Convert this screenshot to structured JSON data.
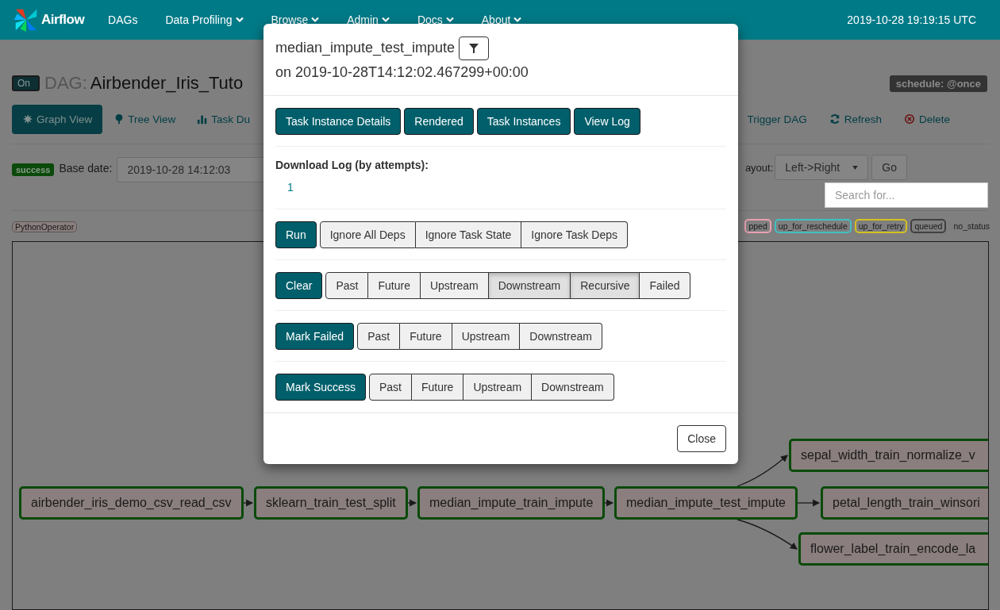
{
  "navbar": {
    "brand": "Airflow",
    "items": [
      {
        "label": "DAGs",
        "dropdown": false
      },
      {
        "label": "Data Profiling",
        "dropdown": true
      },
      {
        "label": "Browse",
        "dropdown": true
      },
      {
        "label": "Admin",
        "dropdown": true
      },
      {
        "label": "Docs",
        "dropdown": true
      },
      {
        "label": "About",
        "dropdown": true
      }
    ],
    "clock": "2019-10-28 19:19:15 UTC"
  },
  "dag_header": {
    "toggle": "On",
    "prefix": "DAG:",
    "name": "Airbender_Iris_Tuto",
    "schedule": "schedule: @once"
  },
  "view_tabs": [
    {
      "label": "Graph View",
      "selected": true
    },
    {
      "label": "Tree View",
      "selected": false
    },
    {
      "label": "Task Du",
      "selected": false
    }
  ],
  "dag_actions": [
    {
      "label": "Trigger DAG",
      "kind": "plain"
    },
    {
      "label": "Refresh",
      "kind": "refresh"
    },
    {
      "label": "Delete",
      "kind": "delete"
    }
  ],
  "controls": {
    "state": "success",
    "base_date_label": "Base date:",
    "base_date": "2019-10-28 14:12:03",
    "layout_label": "ayout:",
    "layout": "Left->Right",
    "go": "Go",
    "search": {
      "placeholder": "Search for..."
    }
  },
  "operators": [
    {
      "label": "PythonOperator"
    }
  ],
  "states": [
    {
      "label": "pped",
      "color": "#e8a0b0"
    },
    {
      "label": "up_for_reschedule",
      "color": "#40c0c0"
    },
    {
      "label": "up_for_retry",
      "color": "#d4c020"
    },
    {
      "label": "queued",
      "color": "#404040"
    },
    {
      "label": "no_status"
    }
  ],
  "graph": {
    "nodes": [
      {
        "label": "airbender_iris_demo_csv_read_csv"
      },
      {
        "label": "sklearn_train_test_split"
      },
      {
        "label": "median_impute_train_impute"
      },
      {
        "label": "median_impute_test_impute"
      },
      {
        "label": "sepal_width_train_normalize_v"
      },
      {
        "label": "petal_length_train_winsori"
      },
      {
        "label": "flower_label_train_encode_la"
      }
    ]
  },
  "modal": {
    "task": "median_impute_test_impute",
    "date": "on 2019-10-28T14:12:02.467299+00:00",
    "links": [
      "Task Instance Details",
      "Rendered",
      "Task Instances",
      "View Log"
    ],
    "download_label": "Download Log (by attempts):",
    "attempts": [
      "1"
    ],
    "action_rows": [
      {
        "action": "Run",
        "options": [
          {
            "label": "Ignore All Deps",
            "selected": false
          },
          {
            "label": "Ignore Task State",
            "selected": false
          },
          {
            "label": "Ignore Task Deps",
            "selected": false
          }
        ]
      },
      {
        "action": "Clear",
        "options": [
          {
            "label": "Past",
            "selected": false
          },
          {
            "label": "Future",
            "selected": false
          },
          {
            "label": "Upstream",
            "selected": false
          },
          {
            "label": "Downstream",
            "selected": true
          },
          {
            "label": "Recursive",
            "selected": true
          },
          {
            "label": "Failed",
            "selected": false
          }
        ]
      },
      {
        "action": "Mark Failed",
        "options": [
          {
            "label": "Past",
            "selected": false
          },
          {
            "label": "Future",
            "selected": false
          },
          {
            "label": "Upstream",
            "selected": false
          },
          {
            "label": "Downstream",
            "selected": false
          }
        ]
      },
      {
        "action": "Mark Success",
        "options": [
          {
            "label": "Past",
            "selected": false
          },
          {
            "label": "Future",
            "selected": false
          },
          {
            "label": "Upstream",
            "selected": false
          },
          {
            "label": "Downstream",
            "selected": false
          }
        ]
      }
    ],
    "close": "Close"
  }
}
